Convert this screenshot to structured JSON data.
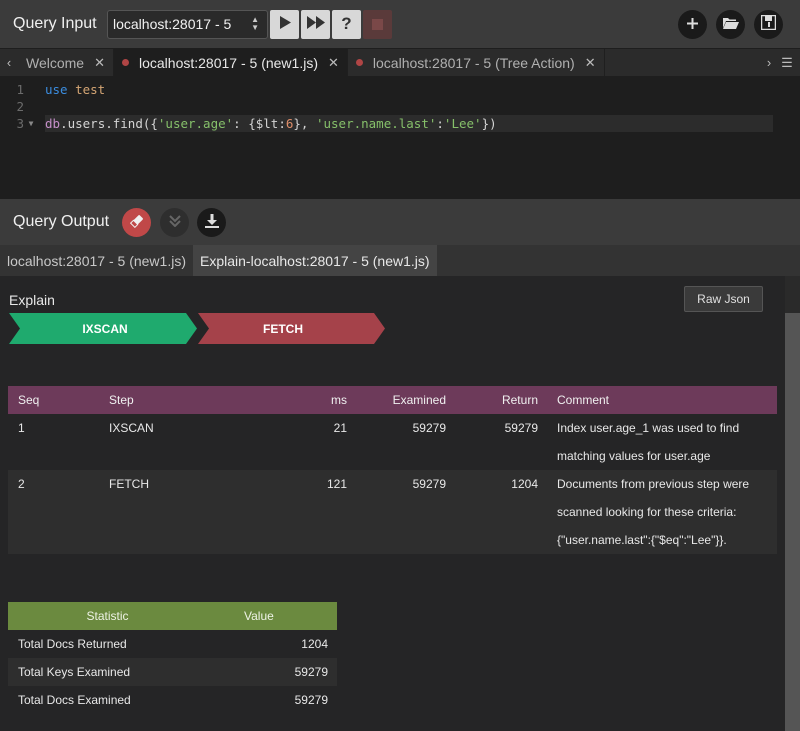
{
  "query_input": {
    "title": "Query Input",
    "connection": "localhost:28017 - 5",
    "help_label": "?"
  },
  "editor_tabs": [
    {
      "label": "Welcome"
    },
    {
      "label": "localhost:28017 - 5 (new1.js)"
    },
    {
      "label": "localhost:28017 - 5 (Tree Action)"
    }
  ],
  "editor": {
    "line_numbers": [
      "1",
      "2",
      "3"
    ],
    "line1": {
      "kw": "use",
      "db": "test"
    },
    "line3": {
      "dbvar": "db",
      "p1": ".users.find({",
      "s1": "'user.age'",
      "p2": ": {$lt:",
      "n1": "6",
      "p3": "}, ",
      "s2": "'user.name.last'",
      "p4": ":",
      "s3": "'Lee'",
      "p5": "})"
    }
  },
  "query_output": {
    "title": "Query Output",
    "tabs": [
      {
        "label": "localhost:28017 - 5 (new1.js)"
      },
      {
        "label": "Explain-localhost:28017 - 5 (new1.js)"
      }
    ]
  },
  "explain": {
    "title": "Explain",
    "raw_json_label": "Raw Json",
    "stages": [
      {
        "label": "IXSCAN",
        "color": "#1faa6e"
      },
      {
        "label": "FETCH",
        "color": "#a5424a"
      }
    ],
    "steps_header": [
      "Seq",
      "Step",
      "ms",
      "Examined",
      "Return",
      "Comment"
    ],
    "steps": [
      {
        "seq": "1",
        "step": "IXSCAN",
        "ms": "21",
        "examined": "59279",
        "return": "59279",
        "comment": [
          "Index user.age_1 was used to find",
          "matching values for user.age"
        ]
      },
      {
        "seq": "2",
        "step": "FETCH",
        "ms": "121",
        "examined": "59279",
        "return": "1204",
        "comment": [
          "Documents from previous step were",
          "scanned looking for these criteria:",
          "{\"user.name.last\":{\"$eq\":\"Lee\"}}."
        ]
      }
    ],
    "stats_header": [
      "Statistic",
      "Value"
    ],
    "stats": [
      {
        "name": "Total Docs Returned",
        "value": "1204"
      },
      {
        "name": "Total Keys Examined",
        "value": "59279"
      },
      {
        "name": "Total Docs Examined",
        "value": "59279"
      }
    ]
  },
  "colors": {
    "steps_header": "#6d3a5a",
    "stats_header": "#6b8a3f",
    "clear_button": "#c04848"
  },
  "icons": [
    "play-icon",
    "fast-forward-icon",
    "help-icon",
    "stop-icon",
    "plus-icon",
    "folder-open-icon",
    "save-icon",
    "eraser-icon",
    "expand-down-icon",
    "download-icon",
    "close-icon",
    "chevron-left-icon",
    "chevron-right-icon",
    "menu-icon"
  ]
}
